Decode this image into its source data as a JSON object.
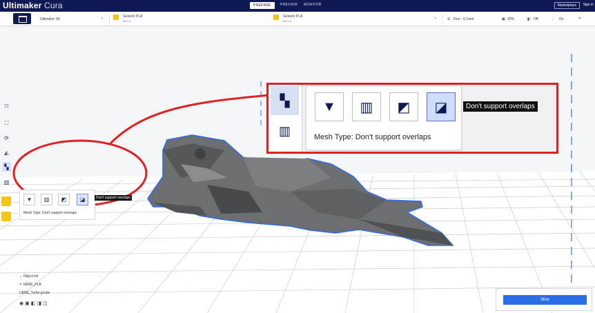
{
  "app": {
    "title_brand": "Ultimaker",
    "title_product": "Cura"
  },
  "header": {
    "stages": [
      {
        "label": "PREPARE",
        "active": true
      },
      {
        "label": "PREVIEW",
        "active": false
      },
      {
        "label": "MONITOR",
        "active": false
      }
    ],
    "marketplace_label": "Marketplace",
    "signin_label": "Sign in"
  },
  "toolbar": {
    "printer_name": "Ultimaker S5",
    "extruder1": {
      "material": "Generic PLA",
      "core": "AA 0.4"
    },
    "extruder2": {
      "material": "Generic PLA",
      "core": "AA 0.4"
    },
    "profile": "Fine - 0.1mm",
    "infill": "20%",
    "support": "Off",
    "adhesion": "On"
  },
  "left_tools": [
    {
      "icon": "move-icon",
      "selected": false
    },
    {
      "icon": "scale-icon",
      "selected": false
    },
    {
      "icon": "rotate-icon",
      "selected": false
    },
    {
      "icon": "mirror-icon",
      "selected": false
    },
    {
      "icon": "per-model-settings-icon",
      "selected": true
    },
    {
      "icon": "support-blocker-icon",
      "selected": false
    },
    {
      "icon": "plugin-a-icon",
      "selected": false
    },
    {
      "icon": "plugin-b-icon",
      "selected": false
    }
  ],
  "mesh_popup_small": {
    "buttons": [
      {
        "icon": "normal-model-icon",
        "selected": false
      },
      {
        "icon": "infill-mesh-icon",
        "selected": false
      },
      {
        "icon": "cutting-mesh-icon",
        "selected": false
      },
      {
        "icon": "dont-support-overlaps-icon",
        "selected": true
      }
    ],
    "label": "Mesh Type: Don't support overlaps",
    "tooltip": "Don't support overlaps"
  },
  "zoom": {
    "label": "Mesh Type: Don't support overlaps",
    "tooltip": "Don't support overlaps"
  },
  "object_list": {
    "header": "Object list",
    "item": "UM3E_PLA",
    "filename": "UM3E_Turtle.gcode"
  },
  "slice_panel": {
    "button_label": "Slice"
  },
  "colors": {
    "header": "#0f1a55",
    "accent": "#2a6ee6",
    "highlight": "#e02020",
    "model_outline": "#2f6bea"
  }
}
